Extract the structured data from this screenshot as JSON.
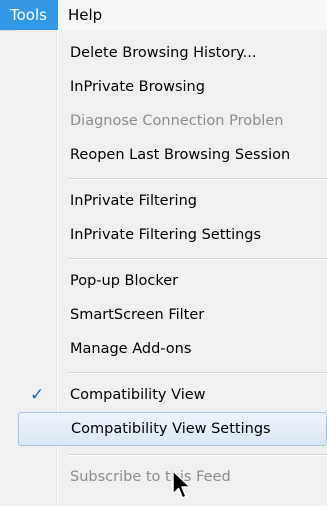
{
  "menubar": {
    "tools": "Tools",
    "help": "Help"
  },
  "menu": {
    "items": [
      {
        "label": "Delete Browsing History..."
      },
      {
        "label": "InPrivate Browsing"
      },
      {
        "label": "Diagnose Connection Problen"
      },
      {
        "label": "Reopen Last Browsing Session"
      },
      {
        "label": "InPrivate Filtering"
      },
      {
        "label": "InPrivate Filtering Settings"
      },
      {
        "label": "Pop-up Blocker"
      },
      {
        "label": "SmartScreen Filter"
      },
      {
        "label": "Manage Add-ons"
      },
      {
        "label": "Compatibility View",
        "check": "✓"
      },
      {
        "label": "Compatibility View Settings"
      },
      {
        "label": "Subscribe to this Feed"
      }
    ]
  },
  "colors": {
    "menubar_active": "#3399e6",
    "hover_border": "#a9c3e2",
    "check": "#1f5fa8",
    "disabled_text": "#8d8d8d"
  }
}
